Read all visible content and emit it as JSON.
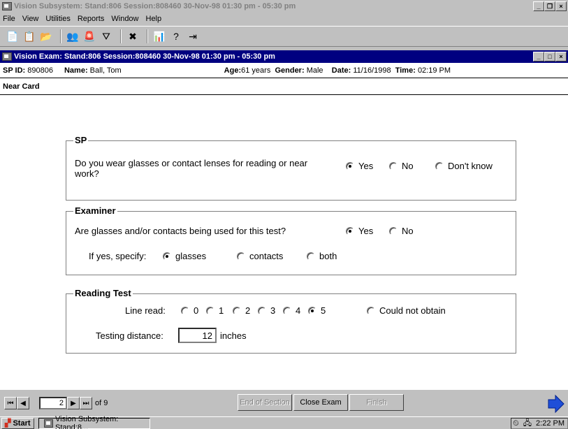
{
  "app": {
    "title": "Vision Subsystem: Stand:806 Session:808460 30-Nov-98 01:30 pm - 05:30 pm",
    "menu": [
      "File",
      "View",
      "Utilities",
      "Reports",
      "Window",
      "Help"
    ]
  },
  "exam_window": {
    "title": "Vision Exam: Stand:806 Session:808460 30-Nov-98 01:30 pm - 05:30 pm"
  },
  "patient": {
    "sp_id_label": "SP ID:",
    "sp_id": "890806",
    "name_label": "Name:",
    "name": "Ball, Tom",
    "age_label": "Age:",
    "age": "61 years",
    "gender_label": "Gender:",
    "gender": "Male",
    "date_label": "Date:",
    "date": "11/16/1998",
    "time_label": "Time:",
    "time": "02:19 PM"
  },
  "section_title": "Near Card",
  "sp_group": {
    "label": "SP",
    "question": "Do you wear glasses or contact lenses for reading or near work?",
    "options": [
      "Yes",
      "No",
      "Don't know"
    ],
    "selected": "Yes"
  },
  "examiner_group": {
    "label": "Examiner",
    "question": "Are glasses and/or contacts being used for this test?",
    "options": [
      "Yes",
      "No"
    ],
    "selected": "Yes",
    "specify_label": "If yes, specify:",
    "specify_options": [
      "glasses",
      "contacts",
      "both"
    ],
    "specify_selected": "glasses"
  },
  "reading_group": {
    "label": "Reading Test",
    "line_read_label": "Line read:",
    "line_options": [
      "0",
      "1",
      "2",
      "3",
      "4",
      "5",
      "Could not obtain"
    ],
    "line_selected": "5",
    "distance_label": "Testing distance:",
    "distance_value": "12",
    "distance_unit": "inches"
  },
  "nav": {
    "page": "2",
    "of_label": "of 9",
    "end_section": "End of Section",
    "close_exam": "Close Exam",
    "finish": "Finish"
  },
  "taskbar": {
    "start": "Start",
    "task": "Vision Subsystem: Stand:8...",
    "clock": "2:22 PM"
  }
}
